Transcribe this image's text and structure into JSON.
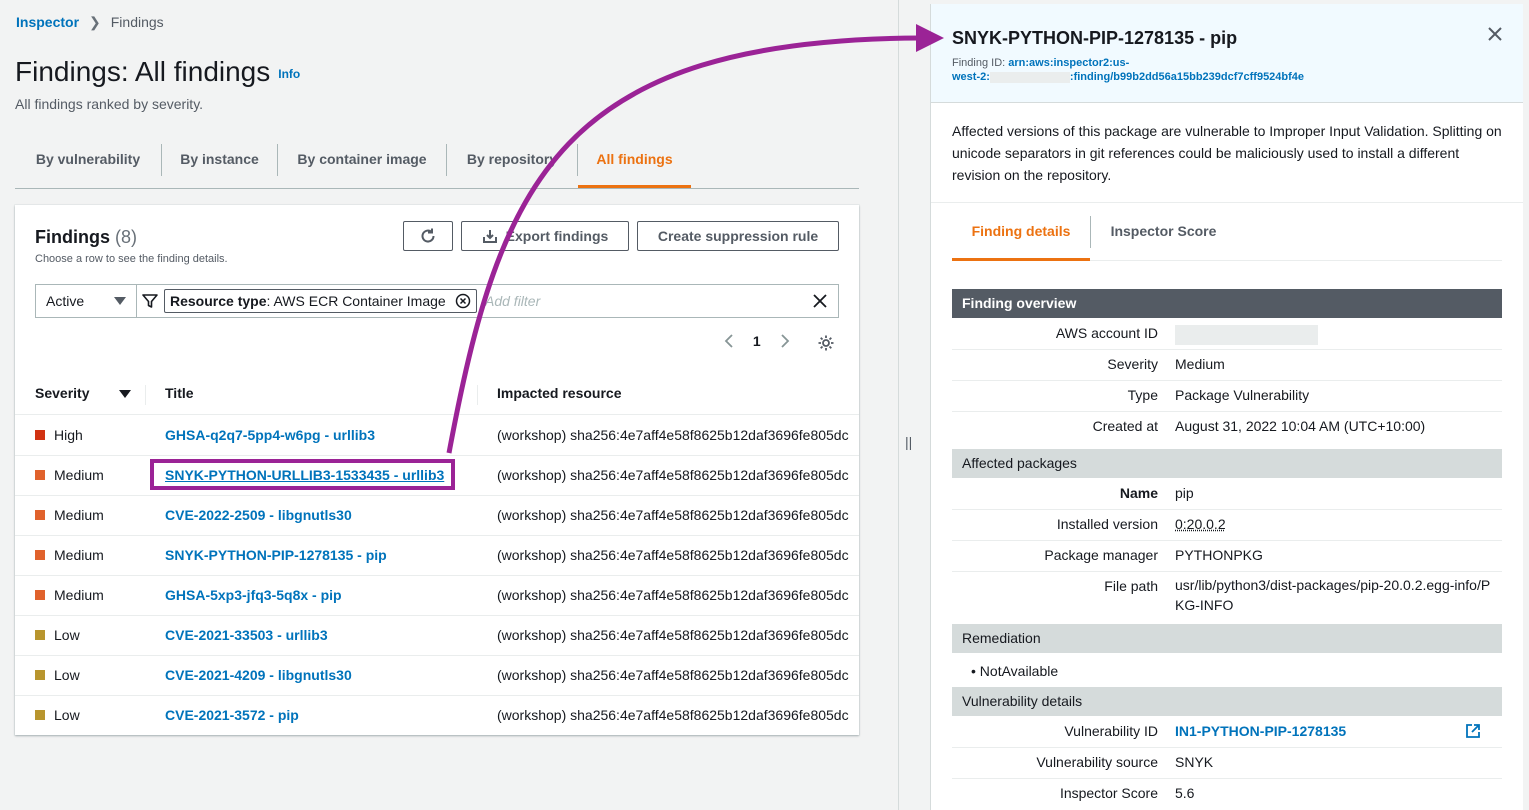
{
  "breadcrumb": {
    "root": "Inspector",
    "current": "Findings"
  },
  "page": {
    "title": "Findings: All findings",
    "info": "Info",
    "subtitle": "All findings ranked by severity."
  },
  "tabs": [
    "By vulnerability",
    "By instance",
    "By container image",
    "By repository",
    "All findings"
  ],
  "findings": {
    "title": "Findings",
    "count": "(8)",
    "description": "Choose a row to see the finding details.",
    "export_label": "Export findings",
    "suppression_label": "Create suppression rule",
    "status_filter": "Active",
    "token_key": "Resource type",
    "token_value": ": AWS ECR Container Image",
    "add_filter_placeholder": "Add filter",
    "page": "1",
    "columns": {
      "severity": "Severity",
      "title": "Title",
      "resource": "Impacted resource"
    },
    "rows": [
      {
        "severity": "High",
        "title": "GHSA-q2q7-5pp4-w6pg - urllib3",
        "resource": "(workshop) sha256:4e7aff4e58f8625b12daf3696fe805dc"
      },
      {
        "severity": "Medium",
        "title": "SNYK-PYTHON-URLLIB3-1533435 - urllib3",
        "resource": "(workshop) sha256:4e7aff4e58f8625b12daf3696fe805dc"
      },
      {
        "severity": "Medium",
        "title": "CVE-2022-2509 - libgnutls30",
        "resource": "(workshop) sha256:4e7aff4e58f8625b12daf3696fe805dc"
      },
      {
        "severity": "Medium",
        "title": "SNYK-PYTHON-PIP-1278135 - pip",
        "resource": "(workshop) sha256:4e7aff4e58f8625b12daf3696fe805dc"
      },
      {
        "severity": "Medium",
        "title": "GHSA-5xp3-jfq3-5q8x - pip",
        "resource": "(workshop) sha256:4e7aff4e58f8625b12daf3696fe805dc"
      },
      {
        "severity": "Low",
        "title": "CVE-2021-33503 - urllib3",
        "resource": "(workshop) sha256:4e7aff4e58f8625b12daf3696fe805dc"
      },
      {
        "severity": "Low",
        "title": "CVE-2021-4209 - libgnutls30",
        "resource": "(workshop) sha256:4e7aff4e58f8625b12daf3696fe805dc"
      },
      {
        "severity": "Low",
        "title": "CVE-2021-3572 - pip",
        "resource": "(workshop) sha256:4e7aff4e58f8625b12daf3696fe805dc"
      }
    ]
  },
  "colors": {
    "high": "#d13212",
    "medium": "#e0622c",
    "low": "#b8952e",
    "accent": "#ec7211",
    "link": "#0073bb",
    "highlight": "#9b2396"
  },
  "panel": {
    "title": "SNYK-PYTHON-PIP-1278135 - pip",
    "finding_id_label": "Finding ID:",
    "finding_id_part1": "arn:aws:inspector2:us-",
    "finding_id_part2": "west-2:",
    "finding_id_part3": ":finding/b99b2dd56a15bb239dcf7cff9524bf4e",
    "description": "Affected versions of this package are vulnerable to Improper Input Validation. Splitting on unicode separators in git references could be maliciously used to install a different revision on the repository.",
    "tabs": [
      "Finding details",
      "Inspector Score"
    ],
    "overview": {
      "heading": "Finding overview",
      "account_label": "AWS account ID",
      "severity_label": "Severity",
      "severity": "Medium",
      "type_label": "Type",
      "type": "Package Vulnerability",
      "created_label": "Created at",
      "created": "August 31, 2022 10:04 AM (UTC+10:00)"
    },
    "packages": {
      "heading": "Affected packages",
      "name_label": "Name",
      "name": "pip",
      "version_label": "Installed version",
      "version": "0:20.0.2",
      "manager_label": "Package manager",
      "manager": "PYTHONPKG",
      "path_label": "File path",
      "path": "usr/lib/python3/dist-packages/pip-20.0.2.egg-info/PKG-INFO"
    },
    "remediation": {
      "heading": "Remediation",
      "item": "NotAvailable"
    },
    "vuln": {
      "heading": "Vulnerability details",
      "id_label": "Vulnerability ID",
      "id": "IN1-PYTHON-PIP-1278135",
      "source_label": "Vulnerability source",
      "source": "SNYK",
      "score_label": "Inspector Score",
      "score": "5.6"
    }
  }
}
